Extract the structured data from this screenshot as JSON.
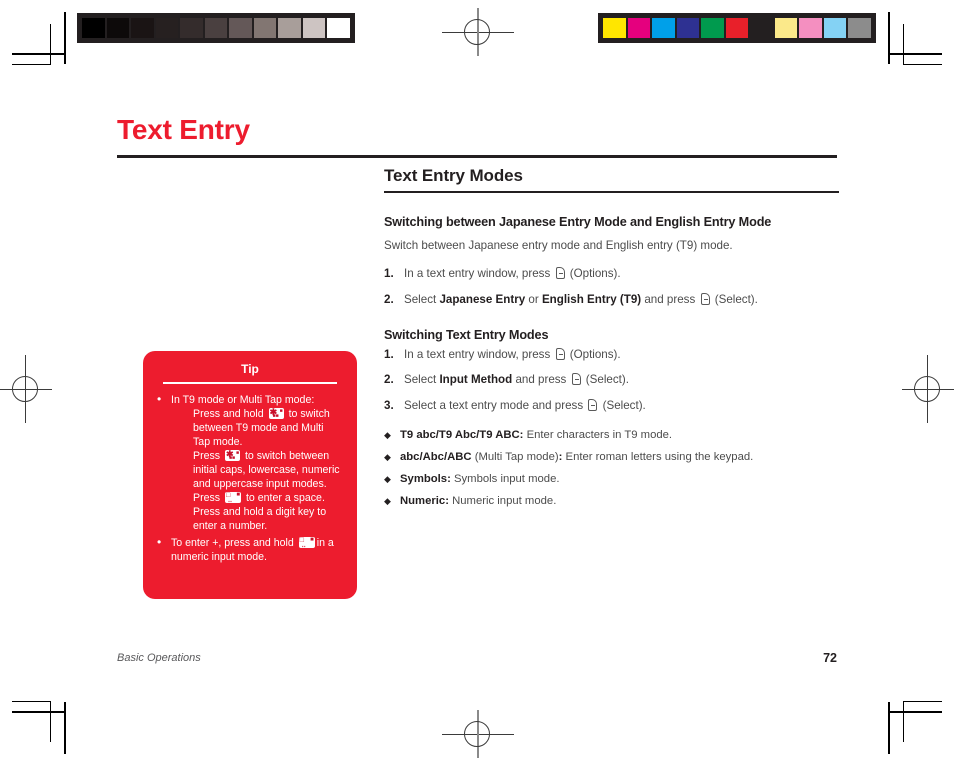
{
  "page": {
    "title": "Text Entry",
    "footer_section": "Basic Operations",
    "page_number": "72",
    "accent_red": "#ed1c2e",
    "ink_black": "#231f20",
    "body_gray": "#4c4c4c"
  },
  "section": {
    "heading": "Text Entry Modes"
  },
  "subsection_1": {
    "heading": "Switching between Japanese Entry Mode and English Entry Mode",
    "lead": "Switch between Japanese entry mode and English entry (T9) mode.",
    "steps": [
      {
        "num": "1.",
        "pre": "In a text entry window, press ",
        "key": "softkey-icon",
        "post": " (Options)."
      },
      {
        "num": "2.",
        "pre": "Select ",
        "bold1": "Japanese Entry",
        "mid1": " or ",
        "bold2": "English Entry (T9)",
        "mid2": " and press ",
        "key": "softkey-icon",
        "post": " (Select)."
      }
    ]
  },
  "subsection_2": {
    "heading": "Switching Text Entry Modes",
    "steps": [
      {
        "num": "1.",
        "pre": "In a text entry window, press ",
        "key": "softkey-icon",
        "post": " (Options)."
      },
      {
        "num": "2.",
        "pre": "Select ",
        "bold1": "Input Method",
        "mid1": " and press ",
        "key": "softkey-icon",
        "post": " (Select)."
      },
      {
        "num": "3.",
        "pre": "Select a text entry mode and press ",
        "key": "softkey-icon",
        "post": " (Select)."
      }
    ],
    "bullets": [
      {
        "marker": "diamond-icon",
        "bold": "T9 abc/T9 Abc/T9 ABC:",
        "text": " Enter characters in T9 mode."
      },
      {
        "marker": "diamond-icon",
        "bold": "abc/Abc/ABC",
        "text_mid": " (Multi Tap mode)",
        "bold_colon": ":",
        "text": " Enter roman letters using the keypad."
      },
      {
        "marker": "diamond-icon",
        "bold": "Symbols:",
        "text": " Symbols input mode."
      },
      {
        "marker": "diamond-icon",
        "bold": "Numeric:",
        "text": " Numeric input mode."
      }
    ]
  },
  "tip": {
    "title": "Tip",
    "bullet_1": {
      "marker": "bullet-dot",
      "line1": "In T9 mode or Multi Tap mode:",
      "para1_pre": "Press and hold ",
      "para1_key": "star-key-icon",
      "para1_post": " to switch between T9 mode and Multi Tap mode.",
      "para2_pre": "Press ",
      "para2_key": "star-key-icon",
      "para2_post": " to switch between initial caps, lowercase, numeric and uppercase input modes.",
      "para3_pre": "Press ",
      "para3_key": "hash-key-icon",
      "para3_post": " to enter a space.",
      "para4": "Press and hold a digit key to enter a number."
    },
    "bullet_2": {
      "marker": "bullet-dot",
      "pre": "To enter +, press and hold ",
      "key": "hash-key-icon",
      "post": "in a numeric input mode."
    }
  },
  "calibration": {
    "grayscale_patches": [
      "#000000",
      "#0d0a0a",
      "#1a1414",
      "#262020",
      "#342c2c",
      "#4a4040",
      "#645858",
      "#827672",
      "#a89e9a",
      "#cdc4c2",
      "#ffffff"
    ],
    "color_patches": [
      "#ffe600",
      "#e5007e",
      "#00a0e9",
      "#2e3192",
      "#009a4e",
      "#e8202a",
      "#231f20",
      "#fbe98a",
      "#f48fc0",
      "#84d2f4",
      "#8c8c8c"
    ]
  }
}
